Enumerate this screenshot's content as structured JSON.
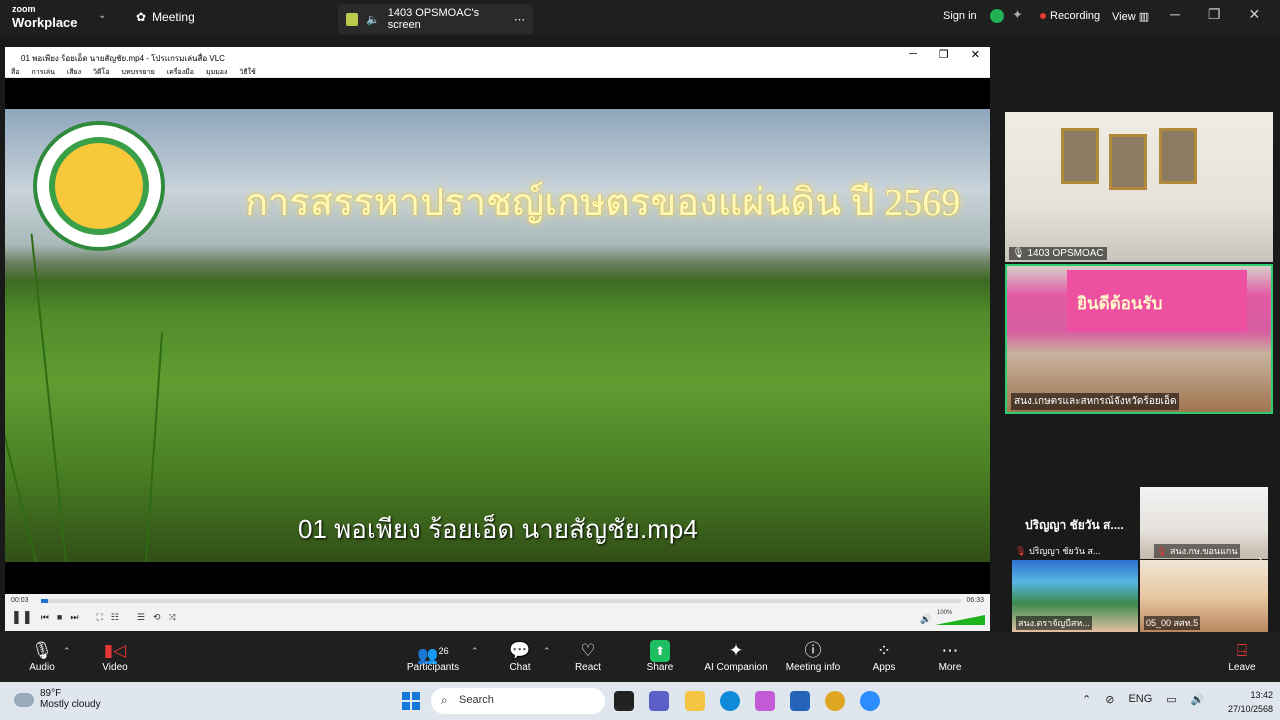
{
  "topbar": {
    "brand_line1": "zoom",
    "brand_line2": "Workplace",
    "meeting_label": "Meeting",
    "share_title": "1403 OPSMOAC's screen",
    "signin_label": "Sign in",
    "recording_label": "Recording",
    "view_label": "View",
    "colors": {
      "bar": "#1f1f1f",
      "recording_dot": "#e53935",
      "shield": "#21b353"
    }
  },
  "vlc": {
    "window_title": "01 พอเพียง ร้อยเอ็ด นายสัญชัย.mp4 - โปรแกรมเล่นสื่อ VLC",
    "menu": [
      "สื่อ",
      "การเล่น",
      "เสียง",
      "วิดีโอ",
      "บทบรรยาย",
      "เครื่องมือ",
      "มุมมอง",
      "วิธีใช้"
    ],
    "video_title": "การสรรหาปราชญ์เกษตรของแผ่นดิน ปี 2569",
    "video_subtitle": "01 พอเพียง ร้อยเอ็ด นายสัญชัย.mp4",
    "time_current": "00:03",
    "time_total": "06:33",
    "progress_fraction": 0.008,
    "volume_label": "100%",
    "volume_level": 1.0
  },
  "participants": {
    "tile1_label": "1403 OPSMOAC",
    "tile2_label": "สนง.เกษตรและสหกรณ์จังหวัดร้อยเอ็ด",
    "tile2_banner": "ยินดีต้อนรับ",
    "strip_name": "ปริญญา ชัยวัน ส....",
    "mini1_label": "ปริญญา ชัยวัน ส...",
    "mini2_label": "สนง.กษ.ขอนแกน",
    "mini3_label": "สนง.ตราจัญบีสห...",
    "mini4_label": "05_00 สศท.5"
  },
  "toolbar": {
    "items": [
      {
        "label": "Audio",
        "icon": "microphone-icon"
      },
      {
        "label": "Video",
        "icon": "video-camera-icon"
      },
      {
        "label": "Participants",
        "icon": "people-icon",
        "count": "26"
      },
      {
        "label": "Chat",
        "icon": "chat-icon"
      },
      {
        "label": "React",
        "icon": "heart-icon"
      },
      {
        "label": "Share",
        "icon": "share-arrow-icon"
      },
      {
        "label": "AI Companion",
        "icon": "sparkle-icon"
      },
      {
        "label": "Meeting info",
        "icon": "info-icon"
      },
      {
        "label": "Apps",
        "icon": "apps-icon"
      },
      {
        "label": "More",
        "icon": "more-icon"
      },
      {
        "label": "Leave",
        "icon": "leave-icon"
      }
    ],
    "colors": {
      "share": "#1dbf60",
      "leave": "#e53935"
    }
  },
  "taskbar": {
    "weather_temp": "89°F",
    "weather_desc": "Mostly cloudy",
    "search_placeholder": "Search",
    "lang": "ENG",
    "time": "13:42",
    "date": "27/10/2568"
  }
}
